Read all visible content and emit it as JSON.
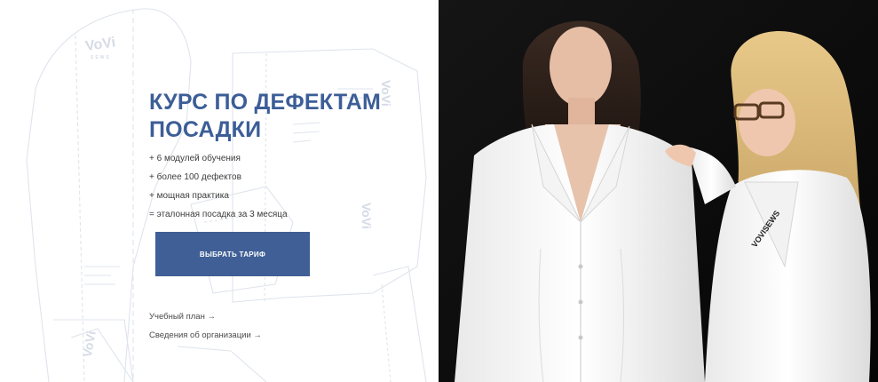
{
  "hero": {
    "title_line1": "КУРС ПО ДЕФЕКТАМ",
    "title_line2": "ПОСАДКИ",
    "features": [
      "+ 6 модулей обучения",
      "+ более 100 дефектов",
      "+ мощная практика",
      "= эталонная посадка за 3 месяца"
    ],
    "cta_label": "ВЫБРАТЬ ТАРИФ",
    "links": {
      "curriculum": "Учебный план →",
      "organization": "Сведения об организации →"
    }
  },
  "pattern": {
    "watermark_brand": "VoVi",
    "watermark_sub": "SEWS"
  },
  "photo": {
    "coat_label": "VOVISEWS"
  },
  "colors": {
    "accent": "#3f5f96",
    "title": "#3c5e97",
    "photo_background": "#0d0d0d"
  }
}
